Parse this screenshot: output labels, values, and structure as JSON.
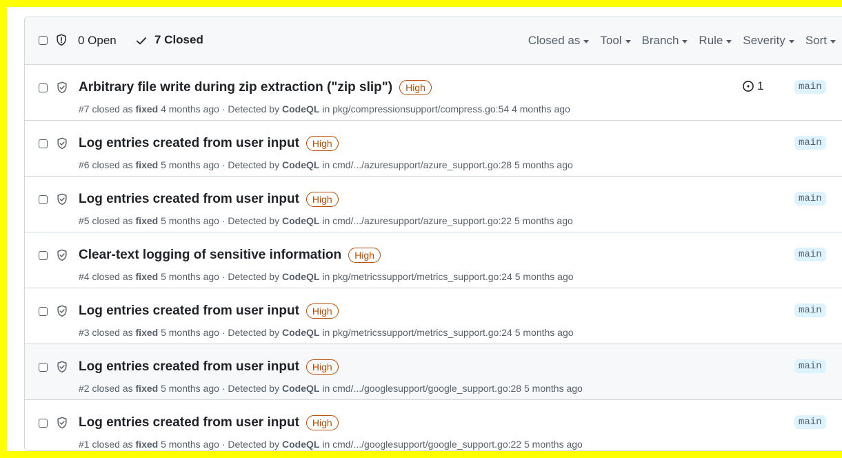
{
  "header": {
    "open_label": "0 Open",
    "closed_label": "7 Closed",
    "filters": [
      "Closed as",
      "Tool",
      "Branch",
      "Rule",
      "Severity",
      "Sort"
    ]
  },
  "alerts": [
    {
      "title": "Arbitrary file write during zip extraction (\"zip slip\")",
      "severity": "High",
      "number": "#7",
      "closed_as": "fixed",
      "closed_ago": "4 months ago",
      "tool": "CodeQL",
      "location": "pkg/compressionsupport/compress.go:54",
      "detected_ago": "4 months ago",
      "linked_issues": "1",
      "branch": "main"
    },
    {
      "title": "Log entries created from user input",
      "severity": "High",
      "number": "#6",
      "closed_as": "fixed",
      "closed_ago": "5 months ago",
      "tool": "CodeQL",
      "location": "cmd/.../azuresupport/azure_support.go:28",
      "detected_ago": "5 months ago",
      "branch": "main"
    },
    {
      "title": "Log entries created from user input",
      "severity": "High",
      "number": "#5",
      "closed_as": "fixed",
      "closed_ago": "5 months ago",
      "tool": "CodeQL",
      "location": "cmd/.../azuresupport/azure_support.go:22",
      "detected_ago": "5 months ago",
      "branch": "main"
    },
    {
      "title": "Clear-text logging of sensitive information",
      "severity": "High",
      "number": "#4",
      "closed_as": "fixed",
      "closed_ago": "5 months ago",
      "tool": "CodeQL",
      "location": "pkg/metricssupport/metrics_support.go:24",
      "detected_ago": "5 months ago",
      "branch": "main"
    },
    {
      "title": "Log entries created from user input",
      "severity": "High",
      "number": "#3",
      "closed_as": "fixed",
      "closed_ago": "5 months ago",
      "tool": "CodeQL",
      "location": "pkg/metricssupport/metrics_support.go:24",
      "detected_ago": "5 months ago",
      "branch": "main"
    },
    {
      "title": "Log entries created from user input",
      "severity": "High",
      "number": "#2",
      "closed_as": "fixed",
      "closed_ago": "5 months ago",
      "tool": "CodeQL",
      "location": "cmd/.../googlesupport/google_support.go:28",
      "detected_ago": "5 months ago",
      "branch": "main"
    },
    {
      "title": "Log entries created from user input",
      "severity": "High",
      "number": "#1",
      "closed_as": "fixed",
      "closed_ago": "5 months ago",
      "tool": "CodeQL",
      "location": "cmd/.../googlesupport/google_support.go:22",
      "detected_ago": "5 months ago",
      "branch": "main"
    }
  ],
  "text": {
    "closed_as_prefix": "closed as",
    "detected_by_prefix": "· Detected by",
    "in_prefix": "in"
  },
  "colors": {
    "highlight_border": "#ffff00",
    "severity_high": "#bc4c00",
    "branch_bg": "#ddf4ff"
  },
  "icons": {
    "header": [
      "shield-alert-icon",
      "check-icon"
    ],
    "row": "shield-check-icon",
    "linked_issue": "issue-opened-icon",
    "filter": "chevron-down-icon"
  }
}
